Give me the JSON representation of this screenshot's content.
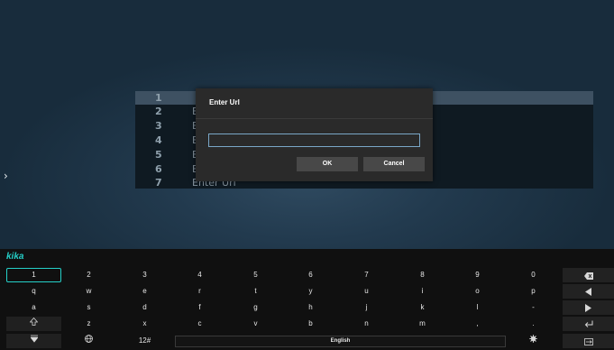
{
  "list": {
    "rows": [
      {
        "num": "1",
        "label": ""
      },
      {
        "num": "2",
        "label": "E"
      },
      {
        "num": "3",
        "label": "E"
      },
      {
        "num": "4",
        "label": "E"
      },
      {
        "num": "5",
        "label": "E"
      },
      {
        "num": "6",
        "label": "E"
      },
      {
        "num": "7",
        "label": "Enter Url"
      }
    ]
  },
  "dialog": {
    "title": "Enter Url",
    "input_value": "",
    "ok_label": "OK",
    "cancel_label": "Cancel"
  },
  "keyboard": {
    "brand": "kika",
    "row1": [
      "1",
      "2",
      "3",
      "4",
      "5",
      "6",
      "7",
      "8",
      "9",
      "0"
    ],
    "row2": [
      "q",
      "w",
      "e",
      "r",
      "t",
      "y",
      "u",
      "i",
      "o",
      "p"
    ],
    "row3": [
      "a",
      "s",
      "d",
      "f",
      "g",
      "h",
      "j",
      "k",
      "l",
      "-"
    ],
    "row4": [
      "z",
      "x",
      "c",
      "v",
      "b",
      "n",
      "m",
      ",",
      "."
    ],
    "symbols_label": "12#",
    "space_label": "English",
    "icons": {
      "backspace": "backspace-icon",
      "left": "arrow-left-icon",
      "right": "arrow-right-icon",
      "enter": "enter-icon",
      "shift": "shift-icon",
      "hide": "hide-keyboard-icon",
      "globe": "globe-icon",
      "settings": "gear-icon",
      "keyboard_switch": "keyboard-switch-icon"
    }
  },
  "colors": {
    "accent": "#25d0c8",
    "input_border": "#7aa7c7",
    "dialog_bg": "#2a2a2a",
    "keyboard_bg": "#101010"
  }
}
